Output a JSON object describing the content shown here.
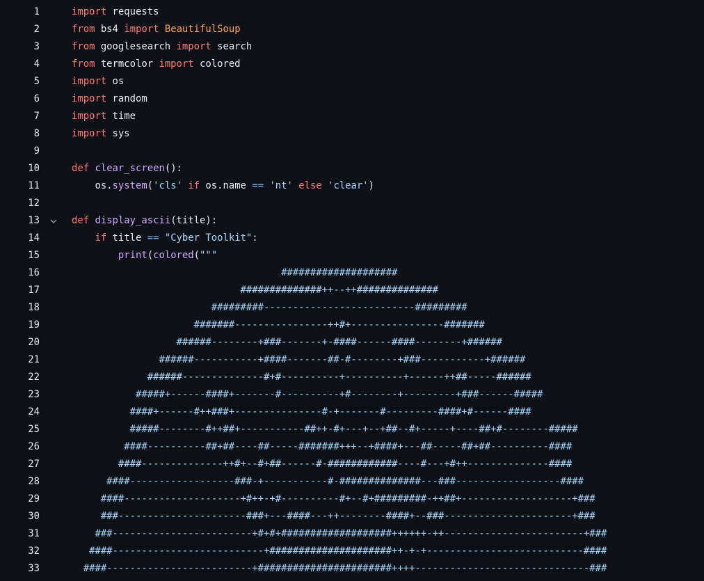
{
  "editor": {
    "line_numbers": [
      "1",
      "2",
      "3",
      "4",
      "5",
      "6",
      "7",
      "8",
      "9",
      "10",
      "11",
      "12",
      "13",
      "14",
      "15",
      "16",
      "17",
      "18",
      "19",
      "20",
      "21",
      "22",
      "23",
      "24",
      "25",
      "26",
      "27",
      "28",
      "29",
      "30",
      "31",
      "32",
      "33"
    ],
    "lines": [
      [
        {
          "t": "kw",
          "v": "import"
        },
        {
          "t": "tx",
          "v": " requests"
        }
      ],
      [
        {
          "t": "kw",
          "v": "from"
        },
        {
          "t": "tx",
          "v": " bs4 "
        },
        {
          "t": "kw",
          "v": "import"
        },
        {
          "t": "tx",
          "v": " "
        },
        {
          "t": "cls",
          "v": "BeautifulSoup"
        }
      ],
      [
        {
          "t": "kw",
          "v": "from"
        },
        {
          "t": "tx",
          "v": " googlesearch "
        },
        {
          "t": "kw",
          "v": "import"
        },
        {
          "t": "tx",
          "v": " search"
        }
      ],
      [
        {
          "t": "kw",
          "v": "from"
        },
        {
          "t": "tx",
          "v": " termcolor "
        },
        {
          "t": "kw",
          "v": "import"
        },
        {
          "t": "tx",
          "v": " colored"
        }
      ],
      [
        {
          "t": "kw",
          "v": "import"
        },
        {
          "t": "tx",
          "v": " os"
        }
      ],
      [
        {
          "t": "kw",
          "v": "import"
        },
        {
          "t": "tx",
          "v": " random"
        }
      ],
      [
        {
          "t": "kw",
          "v": "import"
        },
        {
          "t": "tx",
          "v": " time"
        }
      ],
      [
        {
          "t": "kw",
          "v": "import"
        },
        {
          "t": "tx",
          "v": " sys"
        }
      ],
      [],
      [
        {
          "t": "kw",
          "v": "def"
        },
        {
          "t": "tx",
          "v": " "
        },
        {
          "t": "fn",
          "v": "clear_screen"
        },
        {
          "t": "tx",
          "v": "():"
        }
      ],
      [
        {
          "t": "tx",
          "v": "    os."
        },
        {
          "t": "fn",
          "v": "system"
        },
        {
          "t": "tx",
          "v": "("
        },
        {
          "t": "str",
          "v": "'cls'"
        },
        {
          "t": "tx",
          "v": " "
        },
        {
          "t": "kw",
          "v": "if"
        },
        {
          "t": "tx",
          "v": " os.name "
        },
        {
          "t": "op",
          "v": "=="
        },
        {
          "t": "tx",
          "v": " "
        },
        {
          "t": "str",
          "v": "'nt'"
        },
        {
          "t": "tx",
          "v": " "
        },
        {
          "t": "kw",
          "v": "else"
        },
        {
          "t": "tx",
          "v": " "
        },
        {
          "t": "str",
          "v": "'clear'"
        },
        {
          "t": "tx",
          "v": ")"
        }
      ],
      [],
      [
        {
          "t": "kw",
          "v": "def"
        },
        {
          "t": "tx",
          "v": " "
        },
        {
          "t": "fn",
          "v": "display_ascii"
        },
        {
          "t": "tx",
          "v": "(title):"
        }
      ],
      [
        {
          "t": "tx",
          "v": "    "
        },
        {
          "t": "kw",
          "v": "if"
        },
        {
          "t": "tx",
          "v": " title "
        },
        {
          "t": "op",
          "v": "=="
        },
        {
          "t": "tx",
          "v": " "
        },
        {
          "t": "str",
          "v": "\"Cyber Toolkit\""
        },
        {
          "t": "tx",
          "v": ":"
        }
      ],
      [
        {
          "t": "tx",
          "v": "        "
        },
        {
          "t": "fn",
          "v": "print"
        },
        {
          "t": "tx",
          "v": "("
        },
        {
          "t": "fn",
          "v": "colored"
        },
        {
          "t": "tx",
          "v": "("
        },
        {
          "t": "str",
          "v": "\"\"\""
        }
      ],
      [
        {
          "t": "art",
          "v": "                                    ####################"
        }
      ],
      [
        {
          "t": "art",
          "v": "                             ##############++--++##############"
        }
      ],
      [
        {
          "t": "art",
          "v": "                        #########--------------------------#########"
        }
      ],
      [
        {
          "t": "art",
          "v": "                     #######----------------++#+----------------#######"
        }
      ],
      [
        {
          "t": "art",
          "v": "                  ######--------+###-------+-####------####--------+######"
        }
      ],
      [
        {
          "t": "art",
          "v": "               ######-----------+####-------##-#--------+###-----------+######"
        }
      ],
      [
        {
          "t": "art",
          "v": "             ######--------------#+#----------+----------+------++##-----######"
        }
      ],
      [
        {
          "t": "art",
          "v": "           #####+------####+-------#----------+#--------+---------+###------#####"
        }
      ],
      [
        {
          "t": "art",
          "v": "          ####+------#++###+---------------#-+-------#---------####+#------####"
        }
      ],
      [
        {
          "t": "art",
          "v": "          #####--------#++##+-----------##++-#+---+--+##--#+-----+----##+#--------#####"
        }
      ],
      [
        {
          "t": "art",
          "v": "         ####----------##+##----##-----#######+++--+####+---##-----##+##----------####"
        }
      ],
      [
        {
          "t": "art",
          "v": "        ####--------------++#+--#+##------#-############----#---+#++--------------####"
        }
      ],
      [
        {
          "t": "art",
          "v": "      ####------------------###-+-----------#-##############---###------------------####"
        }
      ],
      [
        {
          "t": "art",
          "v": "     ####--------------------+#++-+#----------#+--#+#########-++##+-------------------+###"
        }
      ],
      [
        {
          "t": "art",
          "v": "     ###----------------------###+---####---++--------####+--###----------------------+###"
        }
      ],
      [
        {
          "t": "art",
          "v": "    ###------------------------+#+#+###################++++++-++------------------------+###"
        }
      ],
      [
        {
          "t": "art",
          "v": "   ####--------------------------+#####################++-+-+---------------------------####"
        }
      ],
      [
        {
          "t": "art",
          "v": "  ####-------------------------+#######################++++------------------------------###"
        }
      ]
    ]
  },
  "fold_line": 13
}
